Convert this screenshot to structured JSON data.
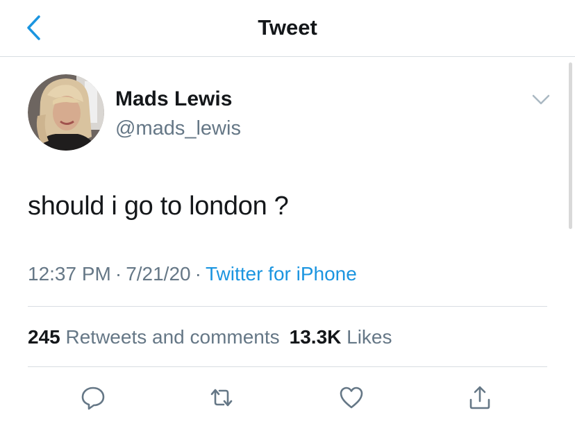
{
  "header": {
    "title": "Tweet",
    "back_icon": "chevron-left-icon"
  },
  "author": {
    "name": "Mads Lewis",
    "handle": "@mads_lewis"
  },
  "tweet": {
    "text": "should i go to london ?",
    "time": "12:37 PM",
    "date": "7/21/20",
    "separator": "·",
    "source": "Twitter for iPhone"
  },
  "stats": {
    "retweets_count": "245",
    "retweets_label": "Retweets and comments",
    "likes_count": "13.3K",
    "likes_label": "Likes"
  },
  "actions": [
    {
      "name": "reply",
      "icon": "speech-bubble-icon"
    },
    {
      "name": "retweet",
      "icon": "retweet-icon"
    },
    {
      "name": "like",
      "icon": "heart-icon"
    },
    {
      "name": "share",
      "icon": "share-icon"
    }
  ],
  "colors": {
    "text_primary": "#14171a",
    "text_secondary": "#657786",
    "accent": "#1b95e0",
    "divider": "#d8dde2"
  }
}
